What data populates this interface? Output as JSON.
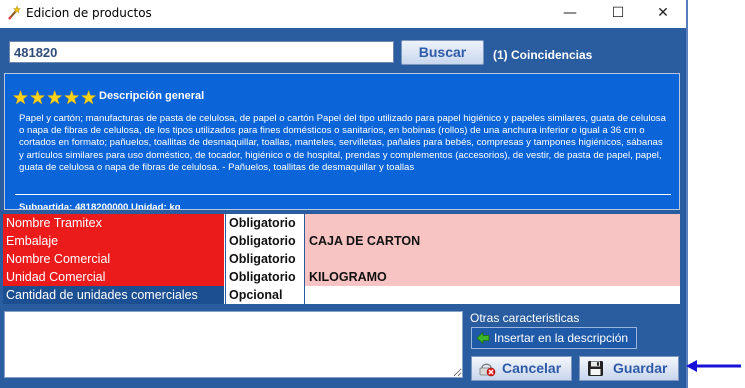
{
  "window": {
    "title": "Edicion de productos",
    "controls": {
      "minimize": "—",
      "maximize": "☐",
      "close": "✕"
    }
  },
  "search": {
    "value": "481820",
    "button_label": "Buscar",
    "matches": "(1) Coincidencias"
  },
  "description": {
    "rating_stars": 5,
    "stars_text": "★★★★★",
    "title": "Descripción general",
    "body": "Papel y cartón; manufacturas de pasta de celulosa, de papel o cartón Papel del tipo utilizado para papel higiénico y papeles similares, guata de celulosa o napa de fibras de celulosa, de los tipos utilizados para fines domésticos o sanitarios, en bobinas (rollos) de una anchura inferior o igual a 36 cm o cortados en formato; pañuelos, toallitas de desmaquillar, toallas, manteles, servilletas, pañales para bebés, compresas y tampones higiénicos, sábanas y artículos similares para uso doméstico, de tocador, higiénico o de hospital, prendas y complementos (accesorios), de vestir, de pasta de papel, papel, guata de celulosa o napa de fibras de celulosa. - Pañuelos, toallitas de desmaquillar y toallas",
    "subpartida": "Subpartida: 4818200000   Unidad: kg"
  },
  "fields": [
    {
      "label": "Nombre Tramitex",
      "requirement": "Obligatorio",
      "value": "",
      "status": "required"
    },
    {
      "label": "Embalaje",
      "requirement": "Obligatorio",
      "value": "CAJA DE CARTON",
      "status": "required"
    },
    {
      "label": "Nombre Comercial",
      "requirement": "Obligatorio",
      "value": "",
      "status": "required"
    },
    {
      "label": "Unidad Comercial",
      "requirement": "Obligatorio",
      "value": "KILOGRAMO",
      "status": "required"
    },
    {
      "label": "Cantidad de unidades comerciales",
      "requirement": "Opcional",
      "value": "",
      "status": "optional"
    }
  ],
  "bottom": {
    "otras_label": "Otras caracteristicas",
    "insert_label": "Insertar en la descripción",
    "notes_value": "",
    "cancel_label": "Cancelar",
    "save_label": "Guardar"
  },
  "colors": {
    "window_bg": "#2a5da0",
    "description_bg": "#0b65d8",
    "required_label": "#ec1b1b",
    "required_value": "#f7c3c3",
    "optional_label": "#1c4e92",
    "annotation_arrow": "#1a10d8"
  },
  "icons": {
    "title": "magic-wand-icon",
    "insert": "green-arrow-left-icon",
    "cancel": "cancel-icon",
    "save": "floppy-disk-icon"
  }
}
